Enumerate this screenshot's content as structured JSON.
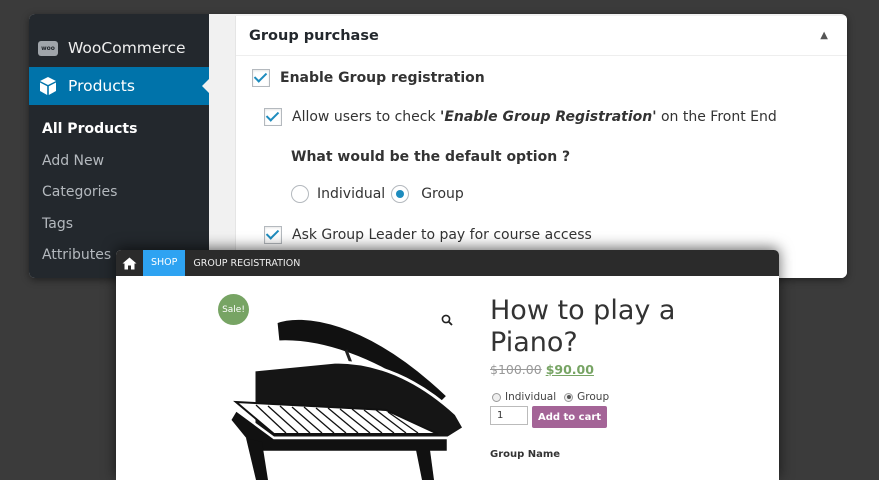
{
  "admin": {
    "sidebar": {
      "woocommerce_label": "WooCommerce",
      "woocommerce_logo_text": "woo",
      "products_label": "Products",
      "items": [
        {
          "label": "All Products",
          "active": true
        },
        {
          "label": "Add New"
        },
        {
          "label": "Categories"
        },
        {
          "label": "Tags"
        },
        {
          "label": "Attributes"
        }
      ]
    },
    "metabox": {
      "title": "Group purchase",
      "enable_group_label": "Enable Group registration",
      "allow_users_prefix": "Allow users to check ",
      "allow_users_emph": "'Enable Group Registration'",
      "allow_users_suffix": " on the Front End",
      "default_question": "What would be the default option ?",
      "option_individual": "Individual",
      "option_group": "Group",
      "selected_option": "Group",
      "ask_leader_label": "Ask Group Leader to pay for course access"
    }
  },
  "shop": {
    "breadcrumb": {
      "shop": "SHOP",
      "current": "GROUP REGISTRATION"
    },
    "sale_badge": "Sale!",
    "product_title": "How to play a Piano?",
    "old_price": "$100.00",
    "new_price": "$90.00",
    "option_individual": "Individual",
    "option_group": "Group",
    "selected_option": "Group",
    "quantity": "1",
    "add_to_cart": "Add to cart",
    "group_name_label": "Group Name"
  },
  "colors": {
    "wp_sidebar": "#23282d",
    "wp_accent": "#0073aa",
    "checkbox_tick": "#1e8cbe",
    "shop_accent": "#2ea3f2",
    "sale_green": "#77a464",
    "add_to_cart": "#a46497"
  }
}
